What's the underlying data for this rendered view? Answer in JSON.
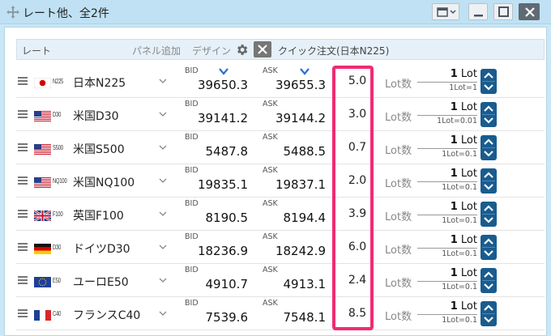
{
  "window": {
    "title": "レート他、全2件",
    "icons": [
      "move-icon",
      "layout-dropdown-icon",
      "minimize-icon",
      "maximize-icon",
      "close-icon"
    ]
  },
  "header": {
    "rate_label": "レート",
    "add_panel_label": "パネル追加",
    "design_label": "デザイン",
    "quick_order_label": "クイック注文(日本N225)"
  },
  "labels": {
    "bid": "BID",
    "ask": "ASK",
    "lot_label": "Lot数"
  },
  "colors": {
    "highlight": "#f02b72",
    "stepper": "#195c8f",
    "bid_arrow": "#2a6fd6"
  },
  "rows": [
    {
      "code": "N225",
      "name": "日本N225",
      "flag": "jp",
      "bid": "39650.3",
      "ask": "39655.3",
      "spread": "5.0",
      "lot_num": "1",
      "lot_suffix": "Lot",
      "lot_unit": "1Lot=1",
      "bid_arrow": true,
      "ask_arrow": true
    },
    {
      "code": "D30",
      "name": "米国D30",
      "flag": "us",
      "bid": "39141.2",
      "ask": "39144.2",
      "spread": "3.0",
      "lot_num": "1",
      "lot_suffix": "Lot",
      "lot_unit": "1Lot=0.01"
    },
    {
      "code": "S500",
      "name": "米国S500",
      "flag": "us",
      "bid": "5487.8",
      "ask": "5488.5",
      "spread": "0.7",
      "lot_num": "1",
      "lot_suffix": "Lot",
      "lot_unit": "1Lot=0.1"
    },
    {
      "code": "NQ100",
      "name": "米国NQ100",
      "flag": "us",
      "bid": "19835.1",
      "ask": "19837.1",
      "spread": "2.0",
      "lot_num": "1",
      "lot_suffix": "Lot",
      "lot_unit": "1Lot=0.1"
    },
    {
      "code": "F100",
      "name": "英国F100",
      "flag": "uk",
      "bid": "8190.5",
      "ask": "8194.4",
      "spread": "3.9",
      "lot_num": "1",
      "lot_suffix": "Lot",
      "lot_unit": "1Lot=0.1"
    },
    {
      "code": "D30",
      "name": "ドイツD30",
      "flag": "de",
      "bid": "18236.9",
      "ask": "18242.9",
      "spread": "6.0",
      "lot_num": "1",
      "lot_suffix": "Lot",
      "lot_unit": "1Lot=0.1"
    },
    {
      "code": "E50",
      "name": "ユーロE50",
      "flag": "eu",
      "bid": "4910.7",
      "ask": "4913.1",
      "spread": "2.4",
      "lot_num": "1",
      "lot_suffix": "Lot",
      "lot_unit": "1Lot=0.1"
    },
    {
      "code": "C40",
      "name": "フランスC40",
      "flag": "fr",
      "bid": "7539.6",
      "ask": "7548.1",
      "spread": "8.5",
      "lot_num": "1",
      "lot_suffix": "Lot",
      "lot_unit": "1Lot=0.1"
    }
  ]
}
